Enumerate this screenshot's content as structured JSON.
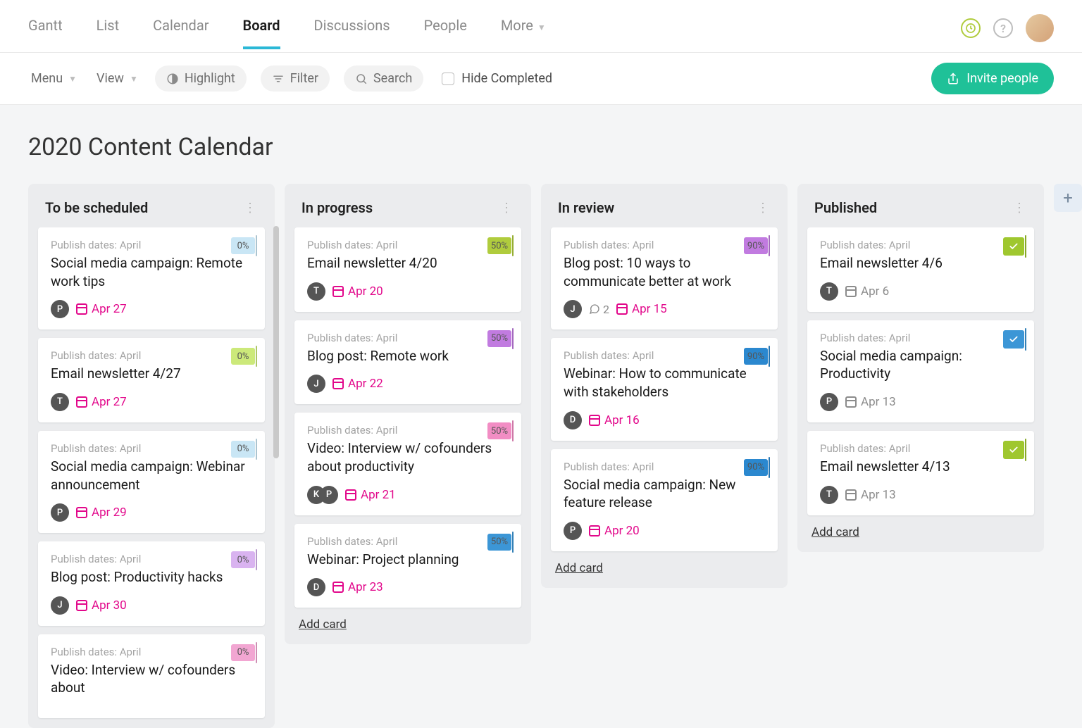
{
  "topnav": {
    "items": [
      "Gantt",
      "List",
      "Calendar",
      "Board",
      "Discussions",
      "People",
      "More"
    ],
    "active_index": 3
  },
  "toolbar": {
    "menu": "Menu",
    "view": "View",
    "highlight": "Highlight",
    "filter": "Filter",
    "search": "Search",
    "hide_completed": "Hide Completed",
    "invite": "Invite people"
  },
  "page_title": "2020 Content Calendar",
  "labels": {
    "add_card": "Add card"
  },
  "badge_colors": {
    "pct0_blue": "#c9e6f5",
    "pct0_green": "#cce97a",
    "pct0_purple": "#d9b3f0",
    "pct0_pink": "#f2a6d2",
    "pct50_green": "#b0cc3d",
    "pct50_purple": "#c17be0",
    "pct50_pink": "#f28dc4",
    "pct50_blue": "#3c96d6",
    "pct90_purple": "#c17be0",
    "pct90_blue": "#2b88cf",
    "check_green": "#9fc72f",
    "check_blue": "#3c96d6"
  },
  "columns": [
    {
      "title": "To be scheduled",
      "cards": [
        {
          "subtext": "Publish dates: April",
          "title": "Social media campaign: Remote work tips",
          "badge": {
            "label": "0%",
            "color_key": "pct0_blue"
          },
          "avatars": [
            "P"
          ],
          "date": "Apr 27",
          "date_muted": false
        },
        {
          "subtext": "Publish dates: April",
          "title": "Email newsletter 4/27",
          "badge": {
            "label": "0%",
            "color_key": "pct0_green"
          },
          "avatars": [
            "T"
          ],
          "date": "Apr 27",
          "date_muted": false
        },
        {
          "subtext": "Publish dates: April",
          "title": "Social media campaign: Webinar announcement",
          "badge": {
            "label": "0%",
            "color_key": "pct0_blue"
          },
          "avatars": [
            "P"
          ],
          "date": "Apr 29",
          "date_muted": false
        },
        {
          "subtext": "Publish dates: April",
          "title": "Blog post: Productivity hacks",
          "badge": {
            "label": "0%",
            "color_key": "pct0_purple"
          },
          "avatars": [
            "J"
          ],
          "date": "Apr 30",
          "date_muted": false
        },
        {
          "subtext": "Publish dates: April",
          "title": "Video: Interview w/ cofounders about",
          "badge": {
            "label": "0%",
            "color_key": "pct0_pink"
          },
          "avatars": [],
          "date": "",
          "date_muted": false
        }
      ],
      "show_add": false,
      "scrollable": true
    },
    {
      "title": "In progress",
      "cards": [
        {
          "subtext": "Publish dates: April",
          "title": "Email newsletter 4/20",
          "badge": {
            "label": "50%",
            "color_key": "pct50_green"
          },
          "avatars": [
            "T"
          ],
          "date": "Apr 20",
          "date_muted": false
        },
        {
          "subtext": "Publish dates: April",
          "title": "Blog post: Remote work",
          "badge": {
            "label": "50%",
            "color_key": "pct50_purple"
          },
          "avatars": [
            "J"
          ],
          "date": "Apr 22",
          "date_muted": false
        },
        {
          "subtext": "Publish dates: April",
          "title": "Video: Interview w/ cofounders about productivity",
          "badge": {
            "label": "50%",
            "color_key": "pct50_pink"
          },
          "avatars": [
            "K",
            "P"
          ],
          "date": "Apr 21",
          "date_muted": false
        },
        {
          "subtext": "Publish dates: April",
          "title": "Webinar: Project planning",
          "badge": {
            "label": "50%",
            "color_key": "pct50_blue"
          },
          "avatars": [
            "D"
          ],
          "date": "Apr 23",
          "date_muted": false
        }
      ],
      "show_add": true
    },
    {
      "title": "In review",
      "cards": [
        {
          "subtext": "Publish dates: April",
          "title": "Blog post: 10 ways to communicate better at work",
          "badge": {
            "label": "90%",
            "color_key": "pct90_purple"
          },
          "avatars": [
            "J"
          ],
          "comments": "2",
          "date": "Apr 15",
          "date_muted": false
        },
        {
          "subtext": "Publish dates: April",
          "title": "Webinar: How to communicate with stakeholders",
          "badge": {
            "label": "90%",
            "color_key": "pct90_blue"
          },
          "avatars": [
            "D"
          ],
          "date": "Apr 16",
          "date_muted": false
        },
        {
          "subtext": "Publish dates: April",
          "title": "Social media campaign: New feature release",
          "badge": {
            "label": "90%",
            "color_key": "pct90_blue"
          },
          "avatars": [
            "P"
          ],
          "date": "Apr 20",
          "date_muted": false
        }
      ],
      "show_add": true
    },
    {
      "title": "Published",
      "cards": [
        {
          "subtext": "Publish dates: April",
          "title": "Email newsletter 4/6",
          "badge": {
            "check": true,
            "color_key": "check_green"
          },
          "avatars": [
            "T"
          ],
          "date": "Apr 6",
          "date_muted": true
        },
        {
          "subtext": "Publish dates: April",
          "title": "Social media campaign: Productivity",
          "badge": {
            "check": true,
            "color_key": "check_blue"
          },
          "avatars": [
            "P"
          ],
          "date": "Apr 13",
          "date_muted": true
        },
        {
          "subtext": "Publish dates: April",
          "title": "Email newsletter 4/13",
          "badge": {
            "check": true,
            "color_key": "check_green"
          },
          "avatars": [
            "T"
          ],
          "date": "Apr 13",
          "date_muted": true
        }
      ],
      "show_add": true
    }
  ]
}
